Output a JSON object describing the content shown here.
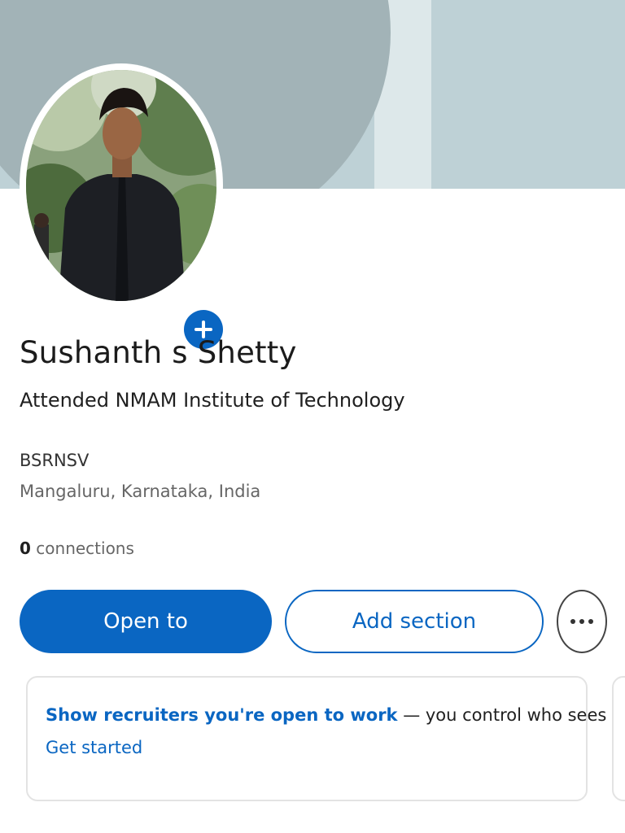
{
  "profile": {
    "name": "Sushanth s Shetty",
    "headline": "Attended NMAM Institute of Technology",
    "company": "BSRNSV",
    "location": "Mangaluru, Karnataka, India",
    "connections_count": "0",
    "connections_label": "connections",
    "avatar_icon": "profile-photo",
    "add_photo_icon": "plus-icon"
  },
  "actions": {
    "open_to_label": "Open to",
    "add_section_label": "Add section",
    "more_icon": "ellipsis-icon"
  },
  "open_to_work_card": {
    "link_text": "Show recruiters you're open to work",
    "rest_text": " — you control who sees this.",
    "cta": "Get started"
  },
  "colors": {
    "accent": "#0a66c2",
    "banner_light": "#bed1d6",
    "banner_dark": "#a2b3b7"
  }
}
